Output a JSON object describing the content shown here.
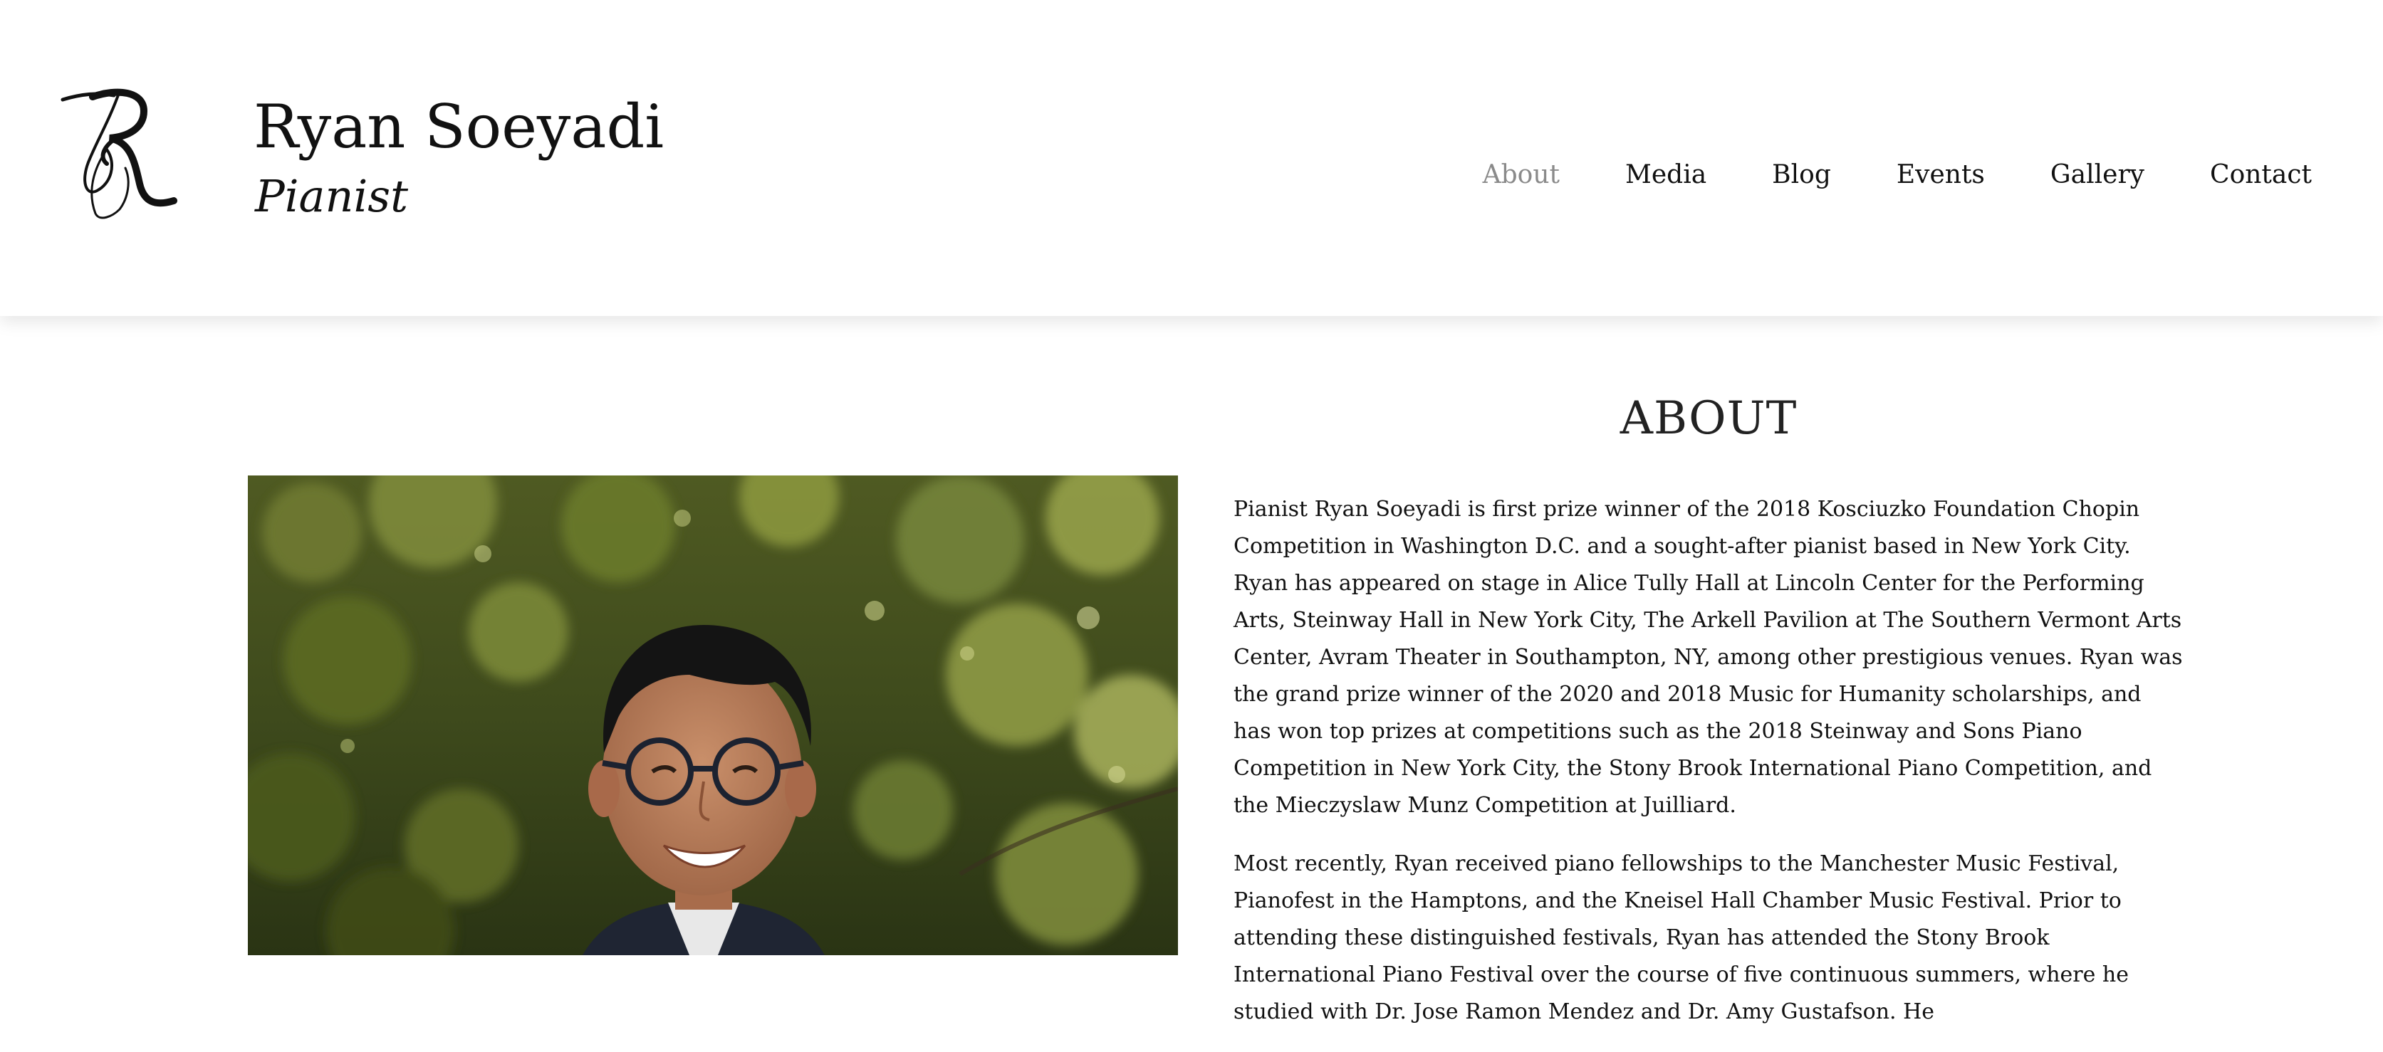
{
  "header": {
    "name": "Ryan Soeyadi",
    "tagline": "Pianist",
    "logo_icon": "rs-monogram-icon"
  },
  "nav": {
    "items": [
      {
        "label": "About",
        "active": true
      },
      {
        "label": "Media",
        "active": false
      },
      {
        "label": "Blog",
        "active": false
      },
      {
        "label": "Events",
        "active": false
      },
      {
        "label": "Gallery",
        "active": false
      },
      {
        "label": "Contact",
        "active": false
      }
    ]
  },
  "about": {
    "title": "ABOUT",
    "paragraphs": [
      "Pianist Ryan Soeyadi is first prize winner of the 2018 Kosciuzko Foundation Chopin Competition in Washington D.C. and a sought-after pianist based in New York City. Ryan has appeared on stage in Alice Tully Hall at Lincoln Center for the Performing Arts, Steinway Hall in New York City, The Arkell Pavilion at The Southern Vermont Arts Center, Avram Theater in Southampton, NY, among other prestigious venues. Ryan was the grand prize winner of the 2020 and 2018 Music for Humanity scholarships, and has won top prizes at competitions such as the 2018 Steinway and Sons Piano Competition in New York City, the Stony Brook International Piano Competition, and the Mieczyslaw Munz Competition at Juilliard.",
      "Most recently, Ryan received piano fellowships to the Manchester Music Festival, Pianofest in the Hamptons, and the Kneisel Hall Chamber Music Festival. Prior to attending these distinguished festivals, Ryan has attended the Stony Brook International Piano Festival over the course of five continuous summers, where he studied with Dr. Jose Ramon Mendez and Dr. Amy Gustafson. He"
    ]
  },
  "colors": {
    "nav_active": "#8a8a8a",
    "text": "#111111",
    "background": "#ffffff"
  }
}
